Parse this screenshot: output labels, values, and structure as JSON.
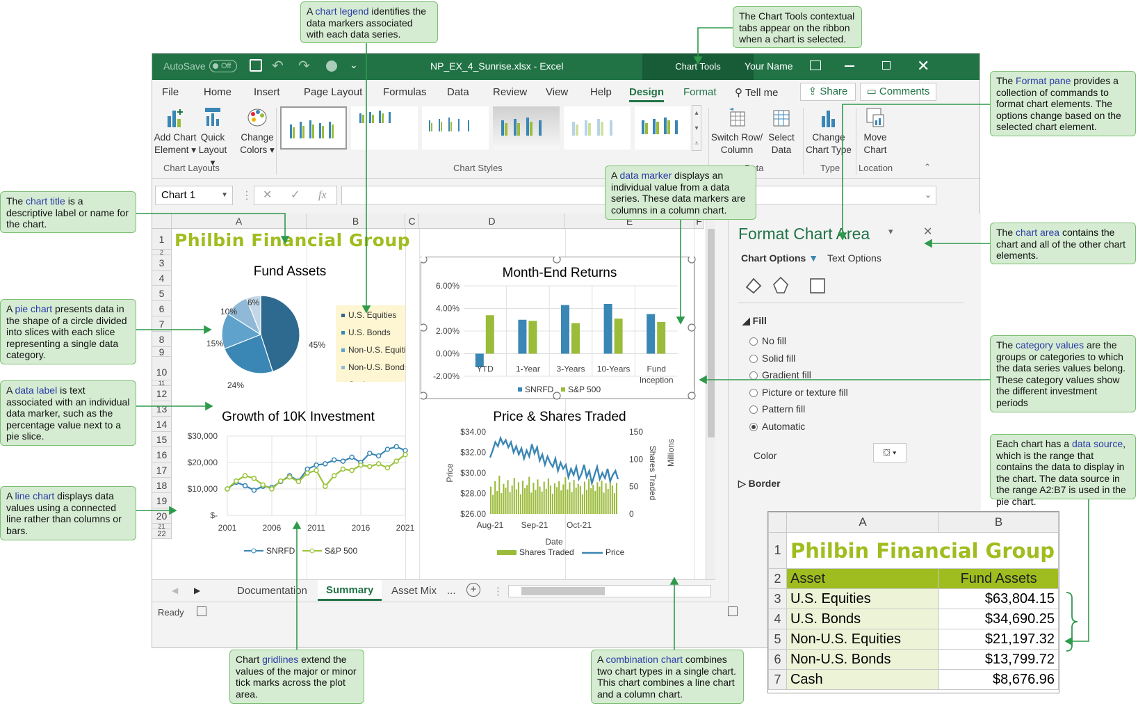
{
  "window": {
    "autosave_label": "AutoSave",
    "autosave_state": "Off",
    "filename": "NP_EX_4_Sunrise.xlsx",
    "app_name": "Excel",
    "contextual_tab": "Chart Tools",
    "user_name": "Your Name"
  },
  "ribbon_tabs": [
    "File",
    "Home",
    "Insert",
    "Page Layout",
    "Formulas",
    "Data",
    "Review",
    "View",
    "Help",
    "Design",
    "Format"
  ],
  "active_tab": "Design",
  "tell_me": "Tell me",
  "share": "Share",
  "comments": "Comments",
  "ribbon": {
    "add_chart_element": "Add Chart Element",
    "quick_layout": "Quick Layout",
    "change_colors": "Change Colors",
    "group_chart_layouts": "Chart Layouts",
    "group_chart_styles": "Chart Styles",
    "switch_row_column": "Switch Row/ Column",
    "select_data": "Select Data",
    "group_data": "Data",
    "change_chart_type": "Change Chart Type",
    "group_type": "Type",
    "move_chart": "Move Chart",
    "group_location": "Location"
  },
  "formula_bar": {
    "name_box": "Chart 1",
    "fx": "fx"
  },
  "sheet": {
    "columns": [
      "A",
      "B",
      "C",
      "D",
      "E",
      "F"
    ],
    "rows": [
      "1",
      "2",
      "3",
      "4",
      "5",
      "6",
      "7",
      "8",
      "9",
      "10",
      "11",
      "12",
      "13",
      "14",
      "15",
      "16",
      "17",
      "18",
      "19",
      "20",
      "21",
      "22"
    ],
    "title": "Philbin Financial Group"
  },
  "sheet_tabs": [
    "Documentation",
    "Summary",
    "Asset Mix"
  ],
  "active_sheet": "Summary",
  "status": "Ready",
  "format_pane": {
    "title": "Format Chart Area",
    "chart_options": "Chart Options",
    "text_options": "Text Options",
    "fill_label": "Fill",
    "fill_options": [
      "No fill",
      "Solid fill",
      "Gradient fill",
      "Picture or texture fill",
      "Pattern fill",
      "Automatic"
    ],
    "selected_fill": "Automatic",
    "color_label": "Color",
    "border_label": "Border"
  },
  "inset": {
    "columns": [
      "A",
      "B"
    ],
    "row_numbers": [
      "1",
      "2",
      "3",
      "4",
      "5",
      "6",
      "7"
    ],
    "title": "Philbin Financial Group",
    "headers": [
      "Asset",
      "Fund Assets"
    ],
    "rows": [
      [
        "U.S. Equities",
        "$63,804.15"
      ],
      [
        "U.S. Bonds",
        "$34,690.25"
      ],
      [
        "Non-U.S. Equities",
        "$21,197.32"
      ],
      [
        "Non-U.S. Bonds",
        "$13,799.72"
      ],
      [
        "Cash",
        "$8,676.96"
      ]
    ]
  },
  "callouts": {
    "legend": [
      "A ",
      "chart legend",
      " identifies the data markers associated with each data series."
    ],
    "chart_tools": "The Chart Tools contextual tabs appear on the ribbon when a chart is selected.",
    "format_pane": [
      "The ",
      "Format pane",
      " provides a collection of commands to format chart elements. The options change based on the selected chart element."
    ],
    "chart_title": [
      "The ",
      "chart title",
      " is a descriptive label or name for the chart."
    ],
    "data_marker": [
      "A ",
      "data marker",
      " displays an individual value from a data series. These data markers are columns in a column chart."
    ],
    "chart_area": [
      "The ",
      "chart area",
      " contains the chart and all of the other chart elements."
    ],
    "pie_chart": [
      "A ",
      "pie chart",
      " presents data in the shape of a circle divided into slices with each slice representing a single data category."
    ],
    "category_values": [
      "The ",
      "category values",
      " are the groups or categories to which the data series values belong. These category values show the different  investment periods"
    ],
    "data_label": [
      "A ",
      "data label",
      " is text associated with an individual data marker, such as  the percentage value next to a pie slice."
    ],
    "data_source": [
      "Each chart has a ",
      "data source",
      ", which is the range that contains the data to display in the chart. The data source in the range A2:B7 is used in the pie chart."
    ],
    "line_chart": [
      "A ",
      "line chart",
      " displays data values using a connected line rather than columns or bars."
    ],
    "gridlines": [
      "Chart ",
      "gridlines",
      " extend the values of the major or minor tick marks across the plot area."
    ],
    "combination": [
      "A ",
      "combination chart",
      " combines two chart types in a single chart. This chart combines a line chart and a column chart."
    ]
  },
  "chart_data": [
    {
      "type": "pie",
      "title": "Fund Assets",
      "categories": [
        "U.S. Equities",
        "U.S. Bonds",
        "Non-U.S. Equities",
        "Non-U.S. Bonds",
        "Cash"
      ],
      "values": [
        45,
        24,
        15,
        10,
        6
      ],
      "labels": [
        "45%",
        "24%",
        "15%",
        "10%",
        "6%"
      ],
      "colors": [
        "#2e6a8f",
        "#3a86b4",
        "#5fa3cc",
        "#8fb9d6",
        "#c1d6e6"
      ],
      "legend": "right"
    },
    {
      "type": "bar",
      "title": "Month-End Returns",
      "categories": [
        "YTD",
        "1-Year",
        "3-Years",
        "10-Years",
        "Fund Inception"
      ],
      "series": [
        {
          "name": "SNRFD",
          "values": [
            -1.2,
            3.0,
            4.3,
            4.4,
            3.5
          ],
          "color": "#3a86b4"
        },
        {
          "name": "S&P 500",
          "values": [
            3.4,
            2.9,
            2.7,
            3.1,
            2.8
          ],
          "color": "#9bbb3a"
        }
      ],
      "ylim": [
        -2,
        6
      ],
      "yticks": [
        "6.00%",
        "4.00%",
        "2.00%",
        "0.00%",
        "-2.00%"
      ],
      "legend": "bottom"
    },
    {
      "type": "line",
      "title": "Growth of 10K Investment",
      "x": [
        2001,
        2002,
        2003,
        2004,
        2005,
        2006,
        2007,
        2008,
        2009,
        2010,
        2011,
        2012,
        2013,
        2014,
        2015,
        2016,
        2017,
        2018,
        2019,
        2020,
        2021
      ],
      "series": [
        {
          "name": "SNRFD",
          "values": [
            10000,
            12500,
            11200,
            9500,
            11000,
            10500,
            12800,
            15000,
            13000,
            17500,
            19000,
            19500,
            21000,
            20500,
            22000,
            20000,
            23500,
            22500,
            25000,
            26000,
            24500
          ],
          "color": "#3a86b4"
        },
        {
          "name": "S&P 500",
          "values": [
            10000,
            13000,
            15000,
            14000,
            11500,
            10000,
            13000,
            14500,
            12800,
            16000,
            17000,
            11000,
            15000,
            17500,
            17000,
            19000,
            18500,
            19500,
            18000,
            20500,
            23000
          ],
          "color": "#9bc33a"
        }
      ],
      "ylim": [
        0,
        30000
      ],
      "yticks": [
        "$30,000",
        "$20,000",
        "$10,000",
        "$-"
      ],
      "xticks": [
        "2001",
        "2006",
        "2011",
        "2016",
        "2021"
      ],
      "legend": "bottom"
    },
    {
      "type": "bar",
      "title": "Price & Shares Traded",
      "xlabel": "Date",
      "ylabel": "Price",
      "y2label": "Shares Traded",
      "y2unit": "Millions",
      "xticks": [
        "Aug-21",
        "Sep-21",
        "Oct-21"
      ],
      "yticks": [
        "$34.00",
        "$32.00",
        "$30.00",
        "$28.00",
        "$26.00"
      ],
      "y2ticks": [
        "150",
        "100",
        "50",
        "0"
      ],
      "ylim": [
        26,
        34
      ],
      "y2lim": [
        0,
        150
      ],
      "series": [
        {
          "name": "Shares Traded",
          "type": "bar",
          "color": "#9bbb3a",
          "values": [
            50,
            35,
            60,
            42,
            70,
            38,
            55,
            48,
            62,
            40,
            52,
            66,
            45,
            58,
            36,
            61,
            47,
            53,
            68,
            39,
            57,
            44,
            63,
            50,
            41,
            59,
            46,
            65,
            52,
            37,
            56,
            49,
            60,
            43,
            54,
            67,
            45,
            58,
            40,
            62,
            48,
            55,
            51,
            36,
            59,
            44,
            64,
            47,
            53,
            42,
            58,
            50,
            61,
            39,
            56,
            46,
            63,
            52,
            38,
            57
          ]
        },
        {
          "name": "Price",
          "type": "line",
          "color": "#3a86b4",
          "values": [
            31.5,
            32.2,
            33.0,
            32.6,
            33.4,
            32.8,
            33.2,
            32.5,
            33.0,
            32.0,
            32.6,
            31.8,
            32.4,
            31.4,
            32.2,
            31.6,
            32.8,
            31.9,
            32.5,
            31.2,
            31.8,
            30.8,
            31.6,
            31.0,
            30.6,
            31.4,
            30.2,
            31.0,
            30.4,
            30.8,
            29.6,
            30.4,
            29.8,
            30.6,
            29.4,
            29.9,
            30.8,
            29.6,
            30.2,
            29.0,
            29.8,
            30.6,
            29.4,
            30.0,
            29.5,
            30.4,
            29.2,
            29.8,
            30.2,
            29.4
          ]
        }
      ],
      "legend": "bottom"
    }
  ]
}
